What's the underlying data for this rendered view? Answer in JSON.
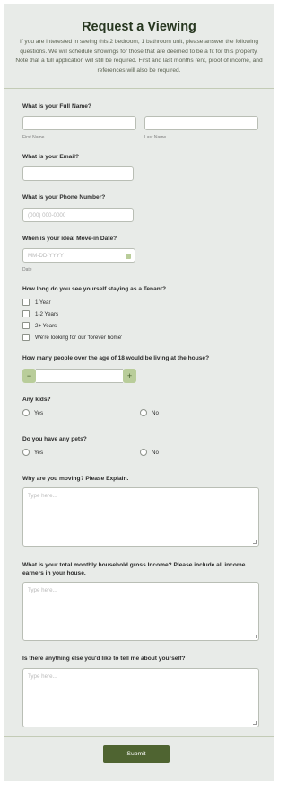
{
  "header": {
    "title": "Request a Viewing",
    "subtitle": "If you are interested in seeing this 2 bedroom, 1 bathroom unit, please answer the following questions. We will schedule showings for those that are deemed to be a fit for this property. Note that a full application will still be required. First and last months rent, proof of income, and references will also be required."
  },
  "full_name": {
    "question": "What is your Full Name?",
    "first_label": "First Name",
    "last_label": "Last Name"
  },
  "email": {
    "question": "What is your Email?"
  },
  "phone": {
    "question": "What is your Phone Number?",
    "placeholder": "(000) 000-0000"
  },
  "move_in": {
    "question": "When is your ideal Move-in Date?",
    "placeholder": "MM-DD-YYYY",
    "sublabel": "Date",
    "icon": "calendar-icon"
  },
  "tenancy": {
    "question": "How long do you see yourself staying as a Tenant?",
    "options": [
      "1 Year",
      "1-2 Years",
      "2+ Years",
      "We're looking for our 'forever home'"
    ]
  },
  "adults": {
    "question": "How many people over the age of 18 would be living at the house?",
    "minus": "−",
    "plus": "+"
  },
  "kids": {
    "question": "Any kids?",
    "yes": "Yes",
    "no": "No"
  },
  "pets": {
    "question": "Do you have any pets?",
    "yes": "Yes",
    "no": "No"
  },
  "moving": {
    "question": "Why are you moving? Please Explain.",
    "placeholder": "Type here..."
  },
  "income": {
    "question": "What is your total monthly household gross Income? Please include all income earners in your house.",
    "placeholder": "Type here..."
  },
  "about": {
    "question": "Is there anything else you'd like to tell me about yourself?",
    "placeholder": "Type here..."
  },
  "submit_label": "Submit",
  "colors": {
    "accent": "#4f6431",
    "accent_light": "#b9cd9a",
    "background": "#e8ebe8"
  }
}
